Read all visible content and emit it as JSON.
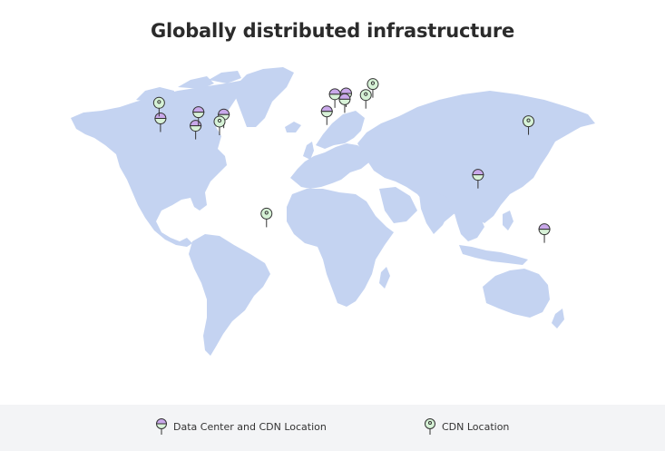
{
  "title": "Globally distributed infrastructure",
  "colors": {
    "land": "#c4d3f1",
    "dc_top": "#c9a8ea",
    "dc_bottom": "#d8f2d8",
    "cdn": "#d6f2d6",
    "outline": "#333333"
  },
  "legend": {
    "data_center_label": "Data Center and CDN Location",
    "cdn_label": "CDN Location"
  },
  "markers": [
    {
      "type": "dc",
      "lon": -122,
      "lat": 37.5
    },
    {
      "type": "cdn",
      "lon": -123,
      "lat": 47.5
    },
    {
      "type": "dc",
      "lon": -97,
      "lat": 32.8
    },
    {
      "type": "dc",
      "lon": -95,
      "lat": 41.5
    },
    {
      "type": "dc",
      "lon": -77,
      "lat": 40
    },
    {
      "type": "cdn",
      "lon": -80,
      "lat": 35.5
    },
    {
      "type": "cdn",
      "lon": -46.6,
      "lat": -23.5
    },
    {
      "type": "dc",
      "lon": -3.7,
      "lat": 42
    },
    {
      "type": "dc",
      "lon": 2,
      "lat": 53
    },
    {
      "type": "dc",
      "lon": 10,
      "lat": 53.5
    },
    {
      "type": "dc",
      "lon": 9,
      "lat": 49.8
    },
    {
      "type": "cdn",
      "lon": 24,
      "lat": 52.5
    },
    {
      "type": "cdn",
      "lon": 29,
      "lat": 59.5
    },
    {
      "type": "cdn",
      "lon": 139.7,
      "lat": 35.7
    },
    {
      "type": "dc",
      "lon": 103.8,
      "lat": 1.35
    },
    {
      "type": "dc",
      "lon": 151,
      "lat": -33.5
    }
  ]
}
